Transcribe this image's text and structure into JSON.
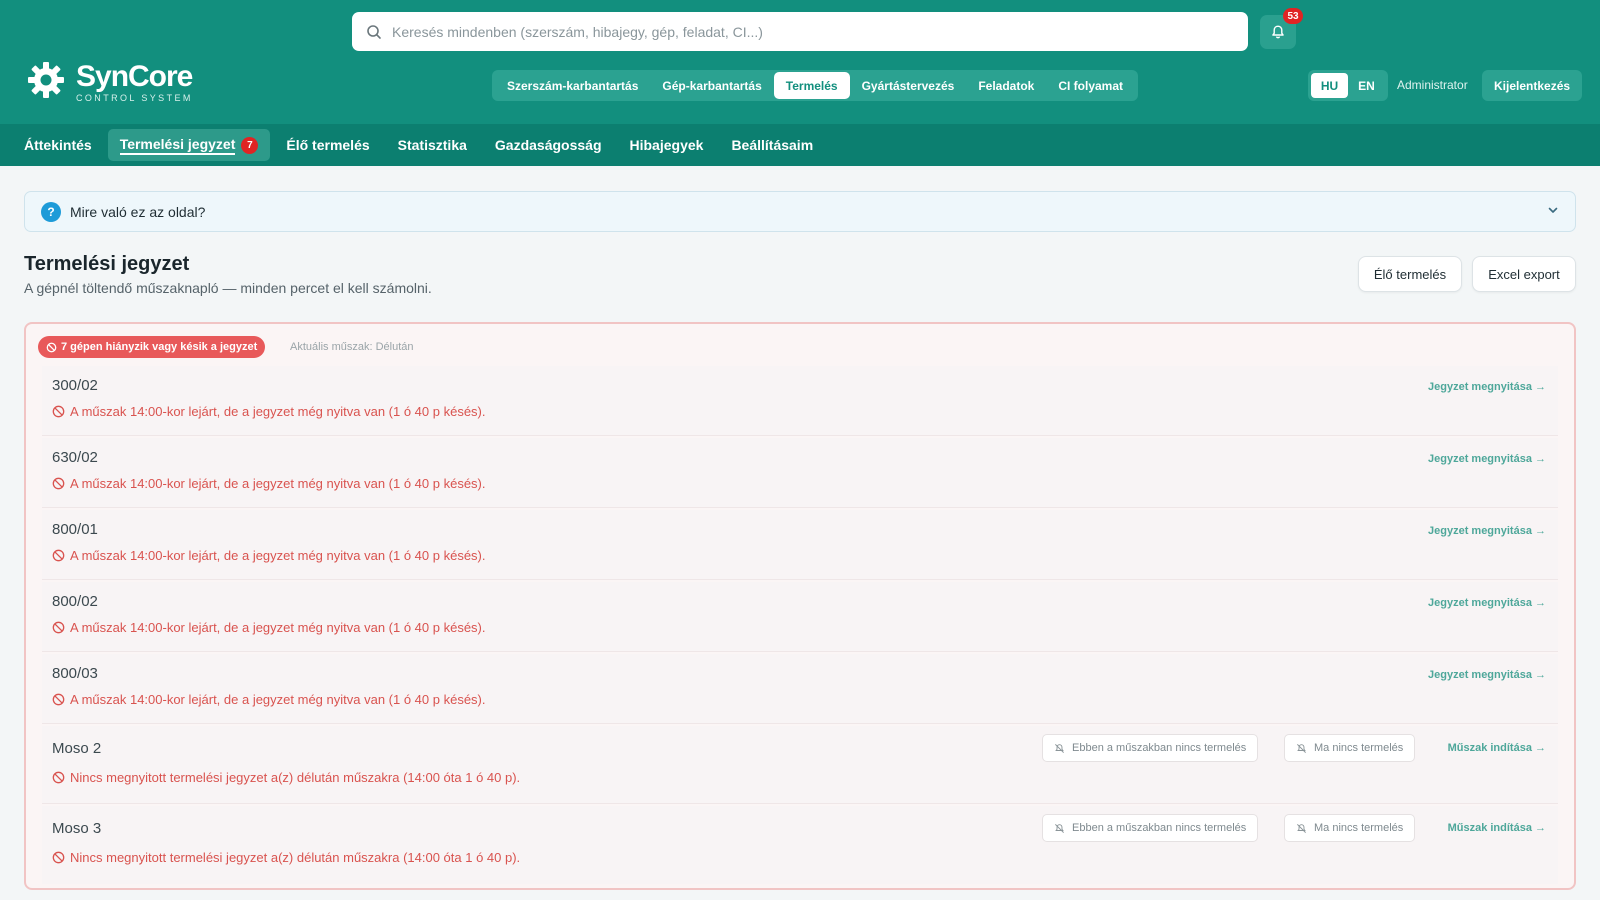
{
  "search": {
    "placeholder": "Keresés mindenben (szerszám, hibajegy, gép, feladat, CI...)"
  },
  "notifications": {
    "count": "53"
  },
  "logo": {
    "name": "SynCore",
    "subtitle": "CONTROL SYSTEM"
  },
  "modules": [
    {
      "label": "Szerszám-karbantartás"
    },
    {
      "label": "Gép-karbantartás"
    },
    {
      "label": "Termelés"
    },
    {
      "label": "Gyártástervezés"
    },
    {
      "label": "Feladatok"
    },
    {
      "label": "CI folyamat"
    }
  ],
  "lang": {
    "hu": "HU",
    "en": "EN"
  },
  "user": {
    "name": "Administrator",
    "logout": "Kijelentkezés"
  },
  "subnav": [
    {
      "label": "Áttekintés"
    },
    {
      "label": "Termelési jegyzet",
      "badge": "7"
    },
    {
      "label": "Élő termelés"
    },
    {
      "label": "Statisztika"
    },
    {
      "label": "Gazdaságosság"
    },
    {
      "label": "Hibajegyek"
    },
    {
      "label": "Beállításaim"
    }
  ],
  "help": {
    "title": "Mire való ez az oldal?"
  },
  "page": {
    "title": "Termelési jegyzet",
    "subtitle": "A gépnél töltendő műszaknapló — minden percet el kell számolni.",
    "btn_live": "Élő termelés",
    "btn_excel": "Excel export"
  },
  "alert": {
    "pill": "7 gépen hiányzik vagy késik a jegyzet",
    "shift": "Aktuális műszak: Délután"
  },
  "rows": [
    {
      "name": "300/02",
      "msg": "A műszak 14:00-kor lejárt, de a jegyzet még nyitva van (1 ó 40 p késés).",
      "link": "Jegyzet megnyitása →"
    },
    {
      "name": "630/02",
      "msg": "A műszak 14:00-kor lejárt, de a jegyzet még nyitva van (1 ó 40 p késés).",
      "link": "Jegyzet megnyitása →"
    },
    {
      "name": "800/01",
      "msg": "A műszak 14:00-kor lejárt, de a jegyzet még nyitva van (1 ó 40 p késés).",
      "link": "Jegyzet megnyitása →"
    },
    {
      "name": "800/02",
      "msg": "A műszak 14:00-kor lejárt, de a jegyzet még nyitva van (1 ó 40 p késés).",
      "link": "Jegyzet megnyitása →"
    },
    {
      "name": "800/03",
      "msg": "A műszak 14:00-kor lejárt, de a jegyzet még nyitva van (1 ó 40 p késés).",
      "link": "Jegyzet megnyitása →"
    },
    {
      "name": "Moso 2",
      "msg": "Nincs megnyitott termelési jegyzet a(z) délután műszakra (14:00 óta 1 ó 40 p).",
      "tag1": "Ebben a műszakban nincs termelés",
      "tag2": "Ma nincs termelés",
      "link": "Műszak indítása →"
    },
    {
      "name": "Moso 3",
      "msg": "Nincs megnyitott termelési jegyzet a(z) délután műszakra (14:00 óta 1 ó 40 p).",
      "tag1": "Ebben a műszakban nincs termelés",
      "tag2": "Ma nincs termelés",
      "link": "Műszak indítása →"
    }
  ],
  "colors": {
    "brand": "#128f7e",
    "subnav": "#0c7f70",
    "alert": "#e8595a",
    "link": "#4ea79a"
  }
}
